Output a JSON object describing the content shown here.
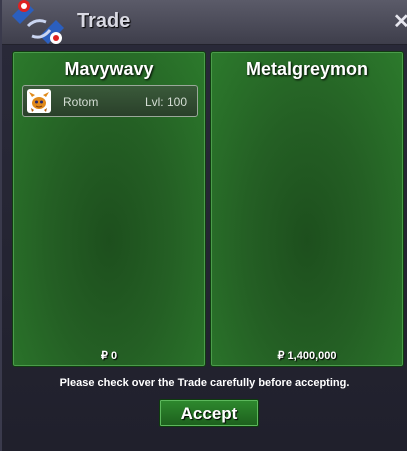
{
  "window": {
    "title": "Trade",
    "close_glyph": "✕",
    "logo_icon": "pokeball-logo-icon"
  },
  "left_panel": {
    "player_name": "Mavywavy",
    "pokemon": [
      {
        "icon": "rotom-icon",
        "name": "Rotom",
        "level": "Lvl: 100"
      }
    ],
    "money": "₽ 0"
  },
  "right_panel": {
    "player_name": "Metalgreymon",
    "pokemon": [],
    "money": "₽ 1,400,000"
  },
  "footer": {
    "notice": "Please check over the Trade carefully before accepting.",
    "accept_label": "Accept"
  },
  "colors": {
    "panel_green": "#2c7a2c",
    "button_green": "#2e8a2e",
    "titlebar": "#4a4a58"
  }
}
